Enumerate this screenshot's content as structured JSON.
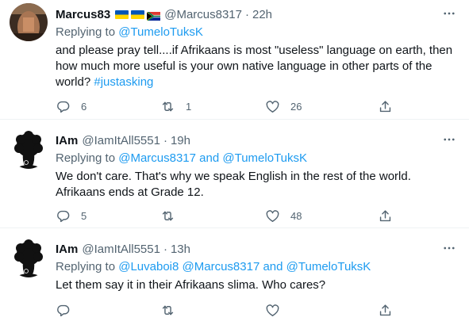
{
  "tweets": [
    {
      "display_name": "Marcus83",
      "handle": "@Marcus8317",
      "time": "22h",
      "replying_prefix": "Replying to ",
      "replying_to": [
        "@TumeloTuksK"
      ],
      "replying_joiner": "",
      "text_lines": [
        "and please pray tell....if Afrikaans is most \"useless\" language on earth, then",
        "how much more useful is your own native language in other parts of the",
        "world? "
      ],
      "hashtag": "#justasking",
      "replies": "6",
      "retweets": "1",
      "likes": "26",
      "flags": [
        "ukraine-flag",
        "ukraine-flag",
        "south-africa-flag"
      ]
    },
    {
      "display_name": "IAm",
      "handle": "@IamItAll5551",
      "time": "19h",
      "replying_prefix": "Replying to ",
      "replying_to": [
        "@Marcus8317",
        "@TumeloTuksK"
      ],
      "replying_joiner": " and ",
      "text_lines": [
        "We don't care. That's why we speak English in the rest of the world.",
        "Afrikaans ends at Grade 12."
      ],
      "replies": "5",
      "retweets": "",
      "likes": "48"
    },
    {
      "display_name": "IAm",
      "handle": "@IamItAll5551",
      "time": "13h",
      "replying_prefix": "Replying to ",
      "replying_to": [
        "@Luvaboi8",
        "@Marcus8317",
        "@TumeloTuksK"
      ],
      "replying_joiner": " and ",
      "text_lines": [
        "Let them say it in their Afrikaans slima. Who cares?"
      ],
      "replies": "",
      "retweets": "",
      "likes": ""
    }
  ],
  "colors": {
    "link": "#1d9bf0",
    "secondary": "#536471",
    "text": "#0f1419",
    "divider": "#eff3f4"
  },
  "icons": [
    "reply-icon",
    "retweet-icon",
    "like-icon",
    "share-icon",
    "more-icon"
  ]
}
